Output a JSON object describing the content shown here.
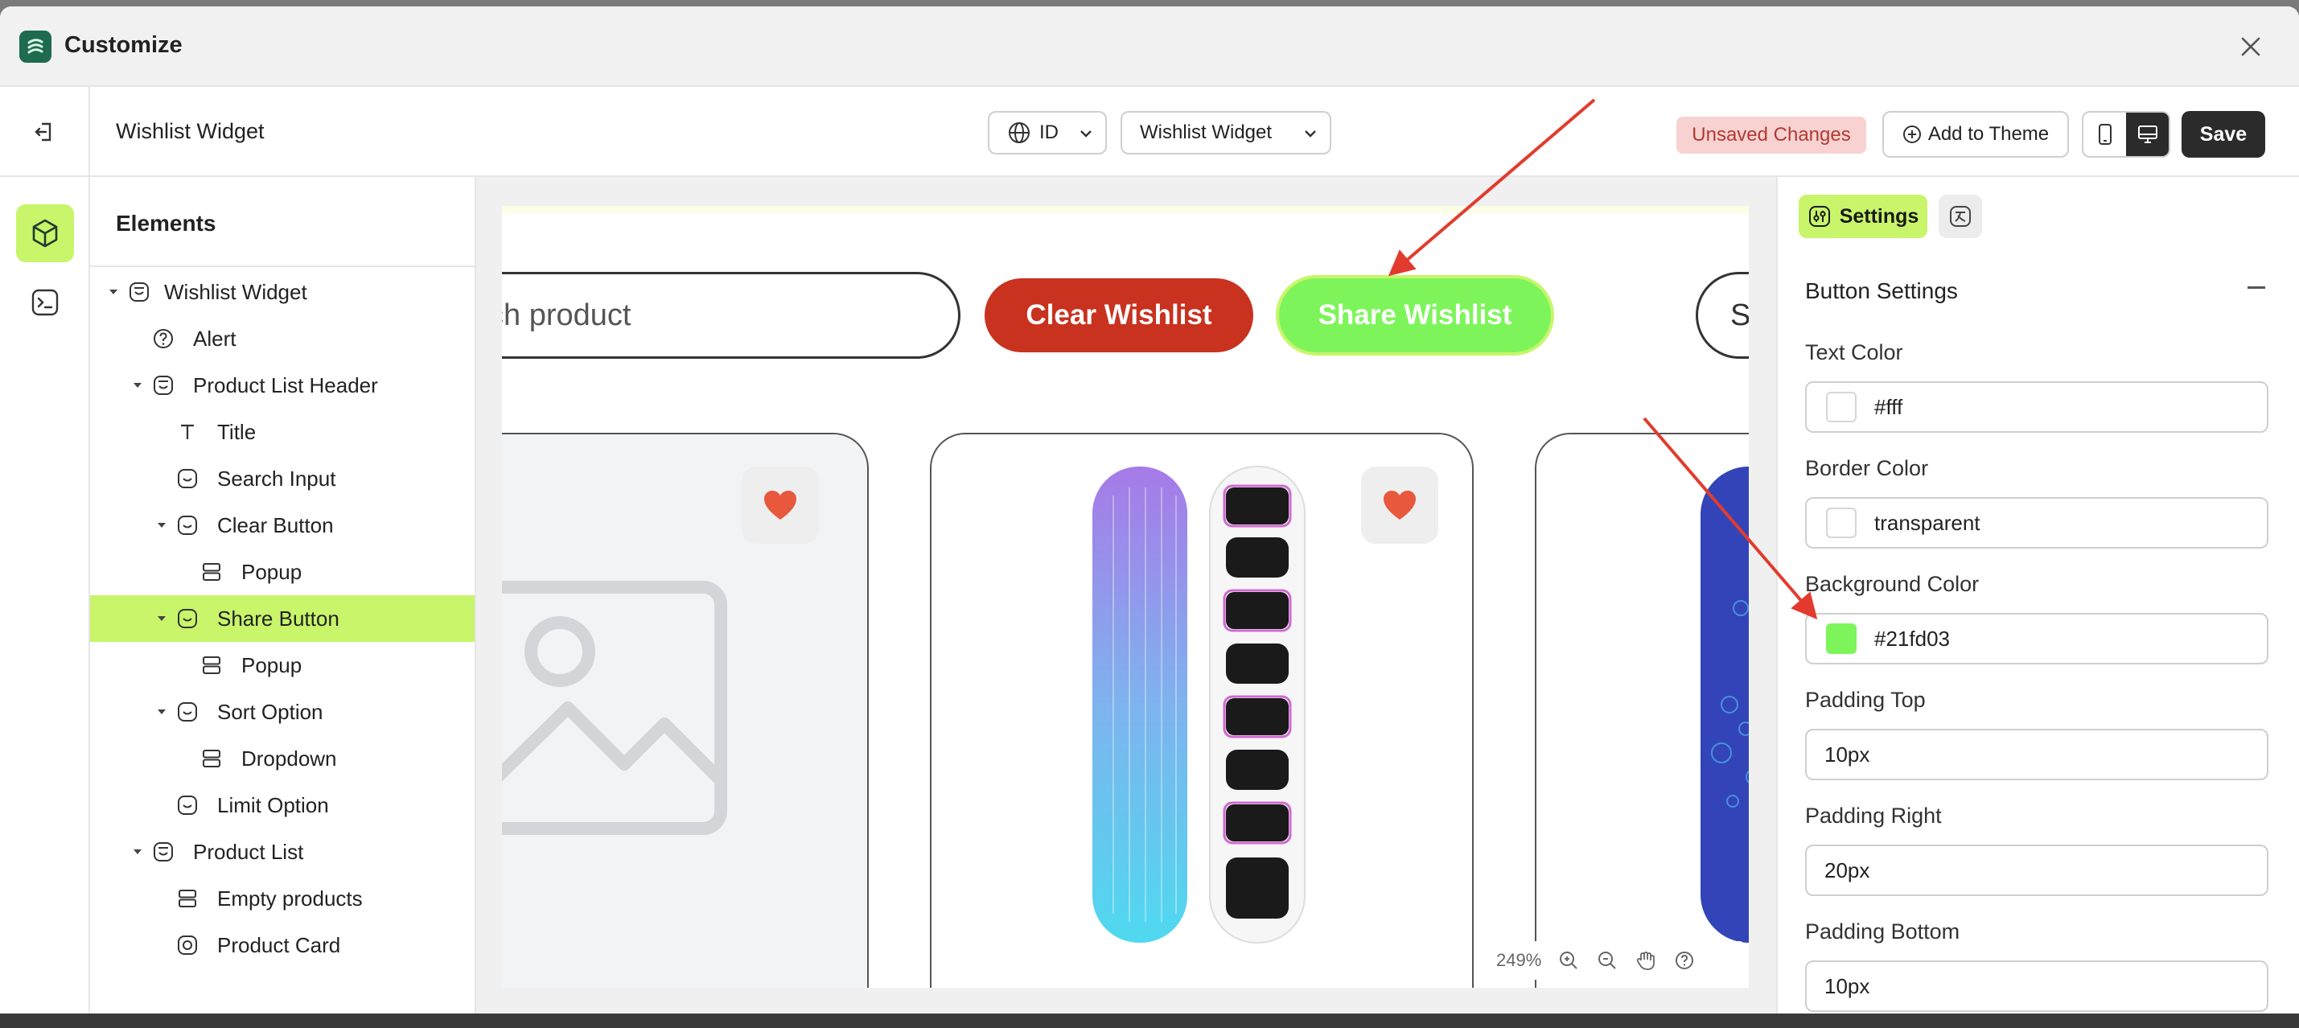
{
  "app": {
    "title": "Customize"
  },
  "toolbar": {
    "page_name": "Wishlist Widget",
    "language": "ID",
    "page_select": "Wishlist Widget",
    "unsaved": "Unsaved Changes",
    "add_to_theme": "Add to Theme",
    "save": "Save"
  },
  "elements": {
    "title": "Elements",
    "tree": [
      {
        "label": "Wishlist Widget",
        "icon": "widget-icon"
      },
      {
        "label": "Alert",
        "icon": "question-circle-icon"
      },
      {
        "label": "Product List Header",
        "icon": "section-icon"
      },
      {
        "label": "Title",
        "icon": "text-icon"
      },
      {
        "label": "Search Input",
        "icon": "block-icon"
      },
      {
        "label": "Clear Button",
        "icon": "block-icon"
      },
      {
        "label": "Popup",
        "icon": "rows-icon"
      },
      {
        "label": "Share Button",
        "icon": "block-icon"
      },
      {
        "label": "Popup",
        "icon": "rows-icon"
      },
      {
        "label": "Sort Option",
        "icon": "block-icon"
      },
      {
        "label": "Dropdown",
        "icon": "rows-icon"
      },
      {
        "label": "Limit Option",
        "icon": "block-icon"
      },
      {
        "label": "Product List",
        "icon": "section-icon"
      },
      {
        "label": "Empty products",
        "icon": "rows-icon"
      },
      {
        "label": "Product Card",
        "icon": "card-icon"
      }
    ]
  },
  "canvas": {
    "search_text": "ch product",
    "clear_label": "Clear Wishlist",
    "share_label": "Share Wishlist",
    "sort_text": "S",
    "zoom": "249%",
    "colors": {
      "clear": "#c8321f",
      "share": "#7df55a",
      "heart": "#e8583c"
    }
  },
  "settings": {
    "tab_settings": "Settings",
    "section": "Button Settings",
    "fields": [
      {
        "label": "Text Color",
        "value": "#fff",
        "swatch": "#ffffff"
      },
      {
        "label": "Border Color",
        "value": "transparent",
        "swatch": "#ffffff"
      },
      {
        "label": "Background Color",
        "value": "#21fd03",
        "swatch": "#7df55a"
      },
      {
        "label": "Padding Top",
        "value": "10px"
      },
      {
        "label": "Padding Right",
        "value": "20px"
      },
      {
        "label": "Padding Bottom",
        "value": "10px"
      }
    ]
  }
}
